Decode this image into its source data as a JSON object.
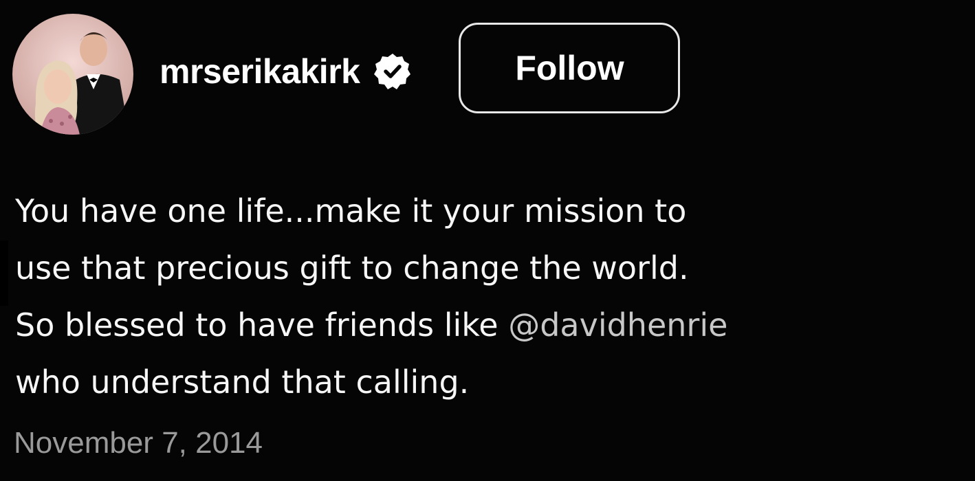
{
  "post": {
    "author": {
      "username": "mrserikakirk",
      "verified_icon": "verified-badge-icon",
      "avatar_icon": "profile-photo"
    },
    "follow_label": "Follow",
    "caption": {
      "line1": "You have one life...make it your mission to",
      "line2": "use that precious gift to change the world.",
      "line3_text": "So blessed to have friends like ",
      "mention": "@davidhenrie",
      "line4": "who understand that calling."
    },
    "date": "November 7, 2014"
  },
  "colors": {
    "background": "#050505",
    "text": "#f6f6f6",
    "mention": "#c8c8c8",
    "date": "#9a9a9a",
    "button_border": "#e8e8e8"
  }
}
